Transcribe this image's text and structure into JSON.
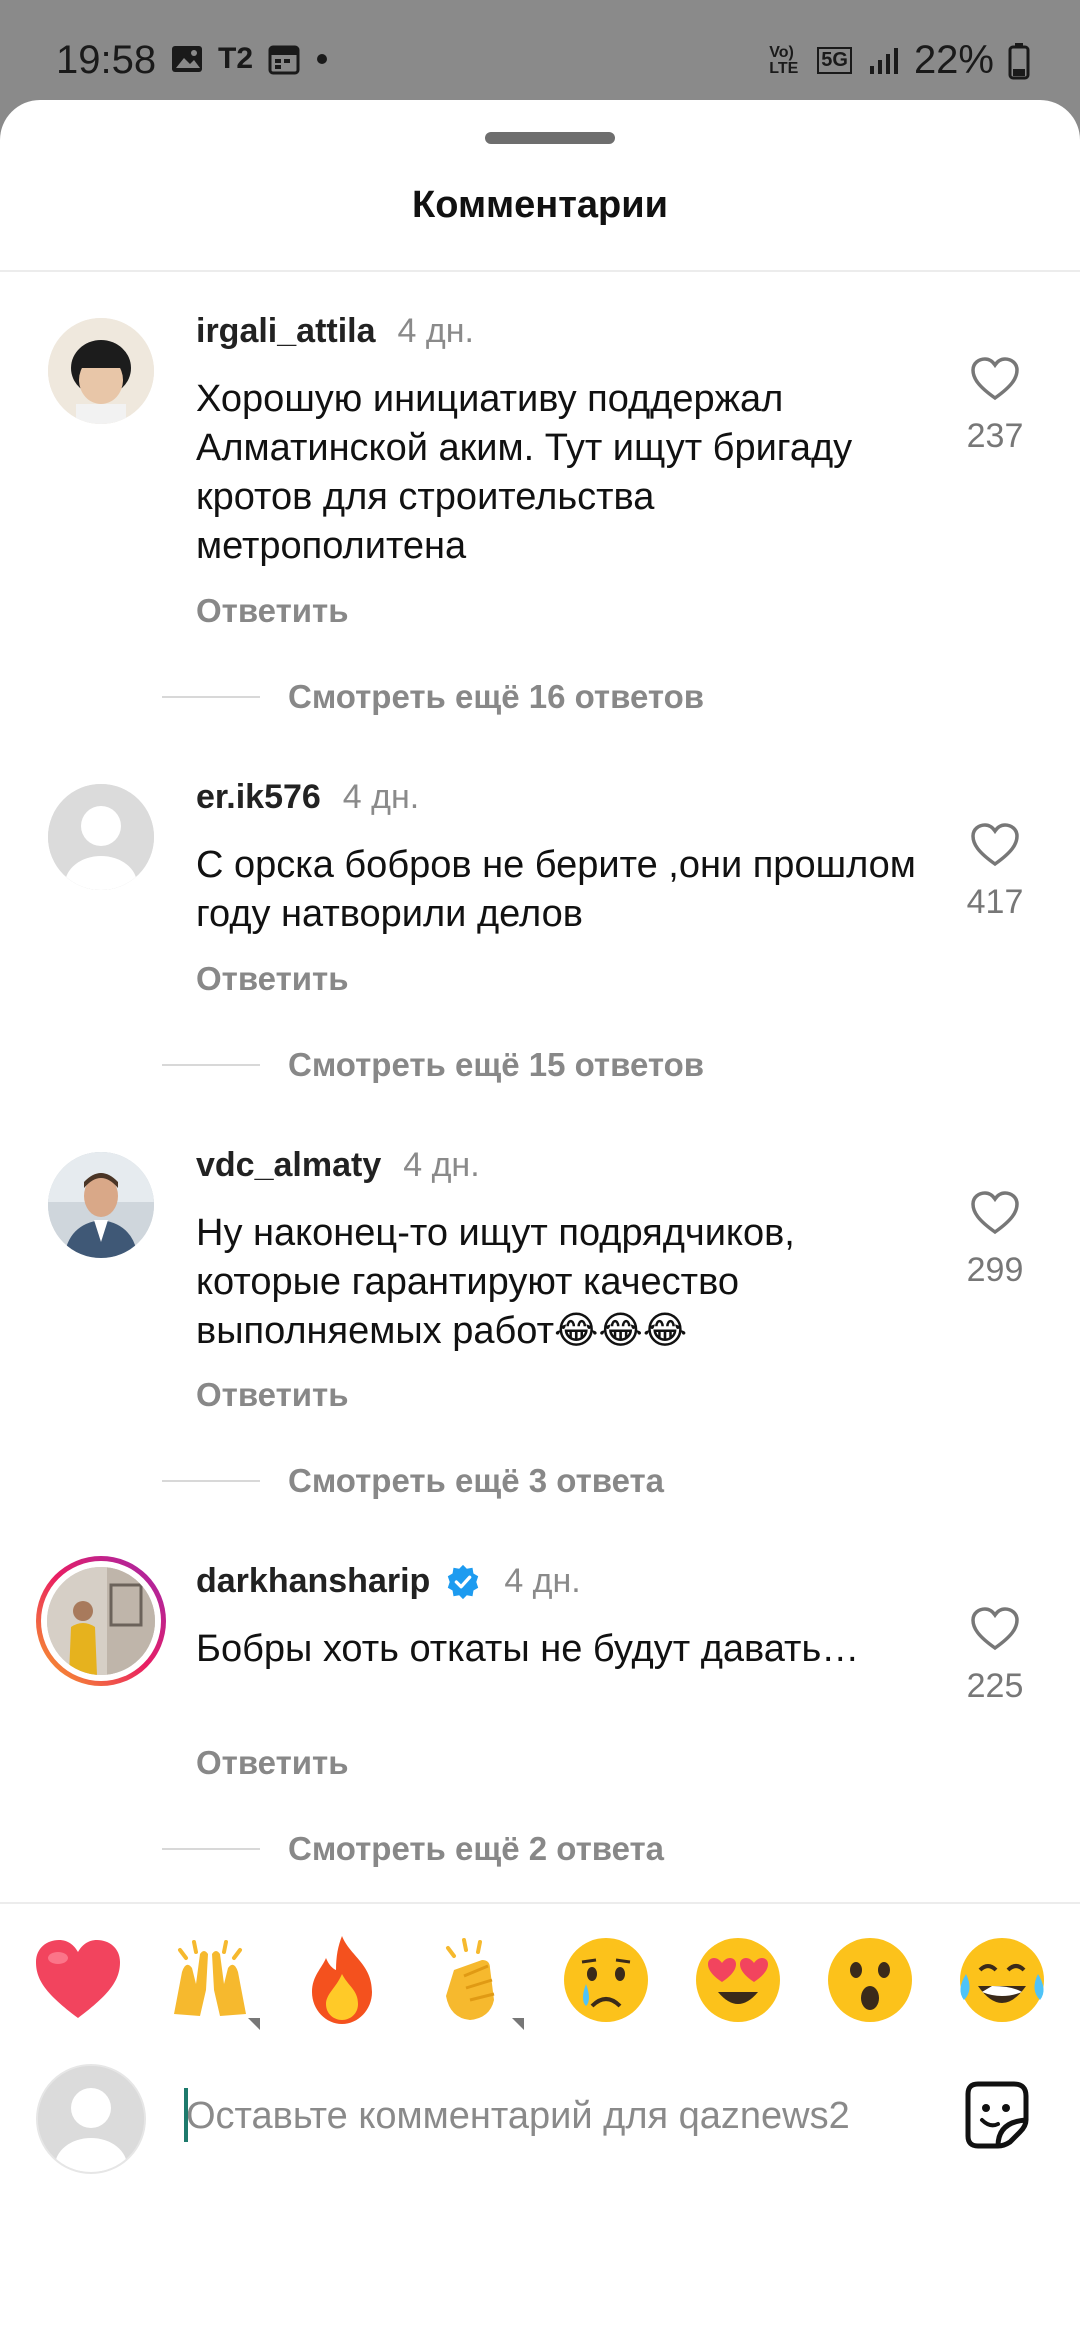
{
  "status_bar": {
    "time": "19:58",
    "carrier_label": "T2",
    "battery": "22%",
    "network_badge": "5G",
    "volte_badge": "Vo) LTE"
  },
  "sheet": {
    "title": "Комментарии"
  },
  "comments": [
    {
      "username": "irgali_attila",
      "time": "4 дн.",
      "text": "Хорошую инициативу поддержал Алматинской аким. Тут ищут бригаду кротов для строительства метрополитена",
      "reply_label": "Ответить",
      "likes": "237",
      "more_replies": "Смотреть ещё 16 ответов",
      "verified": false
    },
    {
      "username": "er.ik576",
      "time": "4 дн.",
      "text": "С орска бобров не берите ,они прошлом году натворили делов",
      "reply_label": "Ответить",
      "likes": "417",
      "more_replies": "Смотреть ещё 15 ответов",
      "verified": false
    },
    {
      "username": "vdc_almaty",
      "time": "4 дн.",
      "text": "Ну наконец-то ищут подрядчиков, которые гарантируют качество выполняемых работ😂😂😂",
      "reply_label": "Ответить",
      "likes": "299",
      "more_replies": "Смотреть ещё 3 ответа",
      "verified": false
    },
    {
      "username": "darkhansharip",
      "time": "4 дн.",
      "text": "Бобры хоть откаты не будут давать…",
      "reply_label": "Ответить",
      "likes": "225",
      "more_replies": "Смотреть ещё 2 ответа",
      "verified": true
    }
  ],
  "reactions": [
    "❤️",
    "🙌",
    "🔥",
    "👏",
    "😢",
    "😍",
    "😮",
    "😂"
  ],
  "composer": {
    "placeholder": "Оставьте комментарий для qaznews2"
  },
  "colors": {
    "accent_verified": "#1d9bf0",
    "story_ring_start": "#f9a825",
    "story_ring_end": "#d81b60",
    "muted_text": "#888888"
  }
}
